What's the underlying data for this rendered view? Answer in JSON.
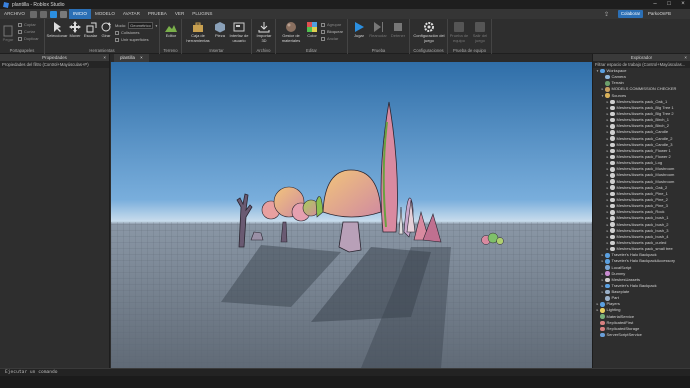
{
  "window": {
    "title": "plantilla - Roblox Studio"
  },
  "menubar": {
    "items": [
      "ARCHIVO",
      "INICIO",
      "MODELO",
      "AVATAR",
      "PRUEBA",
      "VER",
      "PLUGINS"
    ],
    "collab": "Colaborar",
    "user": "ParkoOnFB"
  },
  "ribbon": {
    "clipboard": {
      "items": [
        "Pegar",
        "Copiar",
        "Cortar",
        "Duplicar"
      ],
      "label": "Portapapeles"
    },
    "tools": {
      "items": [
        "Seleccionar",
        "Mover",
        "Escalar",
        "Girar"
      ],
      "label": "Herramientas"
    },
    "mode": {
      "label": "Modo:",
      "value": "Geométrico",
      "collisions": "Colisiones",
      "join": "Unir superficies"
    },
    "terrain": {
      "editor": "Editor",
      "label": "Terreno"
    },
    "insert": {
      "toolbox": "Caja de herramientas",
      "part": "Pieza",
      "ui": "Interfaz de usuario",
      "label": "Insertar"
    },
    "file": {
      "import3d": "Importar 3D",
      "label": "Archivo"
    },
    "edit": {
      "materials": "Gestor de materiales",
      "color": "Color",
      "group": "Agrupar",
      "lock": "Bloquear",
      "anchor": "Anclar",
      "label": "Editar"
    },
    "test": {
      "play": "Jugar",
      "resume": "Reanudar",
      "stop": "Detener",
      "label": "Prueba"
    },
    "settings": {
      "game": "Configuración del juego",
      "label": "Configuraciones"
    },
    "team": {
      "teamtest": "Prueba de equipo",
      "exit": "Salir del juego",
      "label": "Prueba de equipo"
    }
  },
  "left": {
    "title": "Propiedades",
    "filter": "Propiedades del filtro (Control+Mayúsculas+P)"
  },
  "viewport": {
    "tab": "plantilla"
  },
  "explorer": {
    "title": "Explorador",
    "filter": "Filtrar espacio de trabajo (Control+Mayúsculas...",
    "items": [
      {
        "label": "Workspace",
        "indent": 0,
        "arrow": "▾",
        "icon": "#5ba0e0"
      },
      {
        "label": "Camera",
        "indent": 1,
        "arrow": "",
        "icon": "#8fb6d9"
      },
      {
        "label": "Terrain",
        "indent": 1,
        "arrow": "",
        "icon": "#6ca06c"
      },
      {
        "label": "MODELS COMMISSION CHECKER",
        "indent": 1,
        "arrow": "▸",
        "icon": "#c8a060"
      },
      {
        "label": "Sources",
        "indent": 1,
        "arrow": "▾",
        "icon": "#d9b15a"
      },
      {
        "label": "Meshes/Assets pack_Oak_1",
        "indent": 2,
        "arrow": "▸",
        "icon": "#cfcfcf"
      },
      {
        "label": "Meshes/Assets pack_Big Tree 1",
        "indent": 2,
        "arrow": "▸",
        "icon": "#cfcfcf"
      },
      {
        "label": "Meshes/Assets pack_Big Tree 2",
        "indent": 2,
        "arrow": "▸",
        "icon": "#cfcfcf"
      },
      {
        "label": "Meshes/Assets pack_Birch_1",
        "indent": 2,
        "arrow": "▸",
        "icon": "#cfcfcf"
      },
      {
        "label": "Meshes/Assets pack_Birch_2",
        "indent": 2,
        "arrow": "▸",
        "icon": "#cfcfcf"
      },
      {
        "label": "Meshes/Assets pack_Candle",
        "indent": 2,
        "arrow": "▸",
        "icon": "#cfcfcf"
      },
      {
        "label": "Meshes/Assets pack_Candle_2",
        "indent": 2,
        "arrow": "▸",
        "icon": "#cfcfcf"
      },
      {
        "label": "Meshes/Assets pack_Candle_3",
        "indent": 2,
        "arrow": "▸",
        "icon": "#cfcfcf"
      },
      {
        "label": "Meshes/Assets pack_Flower 1",
        "indent": 2,
        "arrow": "▸",
        "icon": "#cfcfcf"
      },
      {
        "label": "Meshes/Assets pack_Flower 2",
        "indent": 2,
        "arrow": "▸",
        "icon": "#cfcfcf"
      },
      {
        "label": "Meshes/Assets pack_Log",
        "indent": 2,
        "arrow": "▸",
        "icon": "#cfcfcf"
      },
      {
        "label": "Meshes/Assets pack_Mushroom",
        "indent": 2,
        "arrow": "▸",
        "icon": "#cfcfcf"
      },
      {
        "label": "Meshes/Assets pack_Mushroom",
        "indent": 2,
        "arrow": "▸",
        "icon": "#cfcfcf"
      },
      {
        "label": "Meshes/Assets pack_Mushroom",
        "indent": 2,
        "arrow": "▸",
        "icon": "#cfcfcf"
      },
      {
        "label": "Meshes/Assets pack_Oak_2",
        "indent": 2,
        "arrow": "▸",
        "icon": "#cfcfcf"
      },
      {
        "label": "Meshes/Assets pack_Pine_1",
        "indent": 2,
        "arrow": "▸",
        "icon": "#cfcfcf"
      },
      {
        "label": "Meshes/Assets pack_Pine_2",
        "indent": 2,
        "arrow": "▸",
        "icon": "#cfcfcf"
      },
      {
        "label": "Meshes/Assets pack_Pine_3",
        "indent": 2,
        "arrow": "▸",
        "icon": "#cfcfcf"
      },
      {
        "label": "Meshes/Assets pack_Rock",
        "indent": 2,
        "arrow": "▸",
        "icon": "#cfcfcf"
      },
      {
        "label": "Meshes/Assets pack_bush_1",
        "indent": 2,
        "arrow": "▸",
        "icon": "#cfcfcf"
      },
      {
        "label": "Meshes/Assets pack_bush_2",
        "indent": 2,
        "arrow": "▸",
        "icon": "#cfcfcf"
      },
      {
        "label": "Meshes/Assets pack_bush_3",
        "indent": 2,
        "arrow": "▸",
        "icon": "#cfcfcf"
      },
      {
        "label": "Meshes/Assets pack_bush_4",
        "indent": 2,
        "arrow": "▸",
        "icon": "#cfcfcf"
      },
      {
        "label": "Meshes/Assets pack_curled",
        "indent": 2,
        "arrow": "▸",
        "icon": "#cfcfcf"
      },
      {
        "label": "Meshes/Assets pack_small tree",
        "indent": 2,
        "arrow": "▸",
        "icon": "#cfcfcf"
      },
      {
        "label": "Traveler's Halo Backpack",
        "indent": 1,
        "arrow": "▸",
        "icon": "#5ba0e0"
      },
      {
        "label": "Traveler's Halo BackpackAccessory",
        "indent": 1,
        "arrow": "▸",
        "icon": "#5ba0e0"
      },
      {
        "label": "LocalScript",
        "indent": 1,
        "arrow": "",
        "icon": "#7aa6d4"
      },
      {
        "label": "Dummy",
        "indent": 1,
        "arrow": "▸",
        "icon": "#c88bd0"
      },
      {
        "label": "MeshesUassets",
        "indent": 1,
        "arrow": "▸",
        "icon": "#cfcfcf"
      },
      {
        "label": "Traveler's Halo Backpack",
        "indent": 1,
        "arrow": "▸",
        "icon": "#5ba0e0"
      },
      {
        "label": "Baseplate",
        "indent": 1,
        "arrow": "▸",
        "icon": "#9ab0c8"
      },
      {
        "label": "Part",
        "indent": 1,
        "arrow": "",
        "icon": "#9ab0c8"
      },
      {
        "label": "Players",
        "indent": 0,
        "arrow": "▸",
        "icon": "#5ba0e0"
      },
      {
        "label": "Lighting",
        "indent": 0,
        "arrow": "▸",
        "icon": "#e8d060"
      },
      {
        "label": "MaterialService",
        "indent": 0,
        "arrow": "",
        "icon": "#7ab07a"
      },
      {
        "label": "ReplicatedFirst",
        "indent": 0,
        "arrow": "",
        "icon": "#d88080"
      },
      {
        "label": "ReplicatedStorage",
        "indent": 0,
        "arrow": "",
        "icon": "#d88080"
      },
      {
        "label": "ServerScriptService",
        "indent": 0,
        "arrow": "",
        "icon": "#6a9ed8"
      }
    ]
  },
  "command": {
    "placeholder": "Ejecutar un comando"
  }
}
